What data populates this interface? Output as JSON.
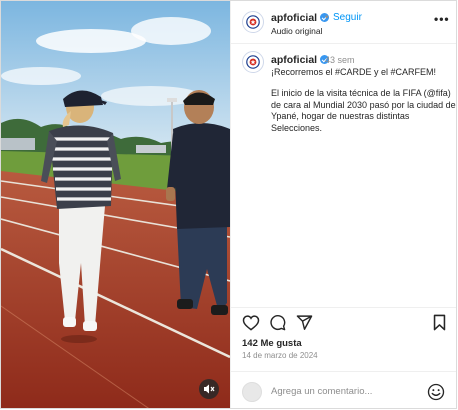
{
  "post": {
    "username": "apfoficial",
    "follow_label": "Seguir",
    "audio_label": "Audio original",
    "more_label": "•••",
    "time_ago": "43 sem",
    "caption_line1": "¡Recorremos el #CARDE y el #CARFEM!",
    "caption_body": "El inicio de la visita técnica de la FIFA (@fifa) de cara al Mundial 2030 pasó por la ciudad de Ypané, hogar de nuestras distintas Selecciones.",
    "likes": "142 Me gusta",
    "date": "14 de marzo de 2024",
    "comment_placeholder": "Agrega un comentario..."
  },
  "icons": {
    "like": "heart-icon",
    "comment": "comment-icon",
    "share": "share-icon",
    "save": "bookmark-icon",
    "mute": "muted-speaker-icon",
    "emoji": "emoji-icon"
  },
  "colors": {
    "link": "#0095f6",
    "verified": "#3897f0",
    "muted_text": "#8e8e8e",
    "track": "#a5361f"
  }
}
